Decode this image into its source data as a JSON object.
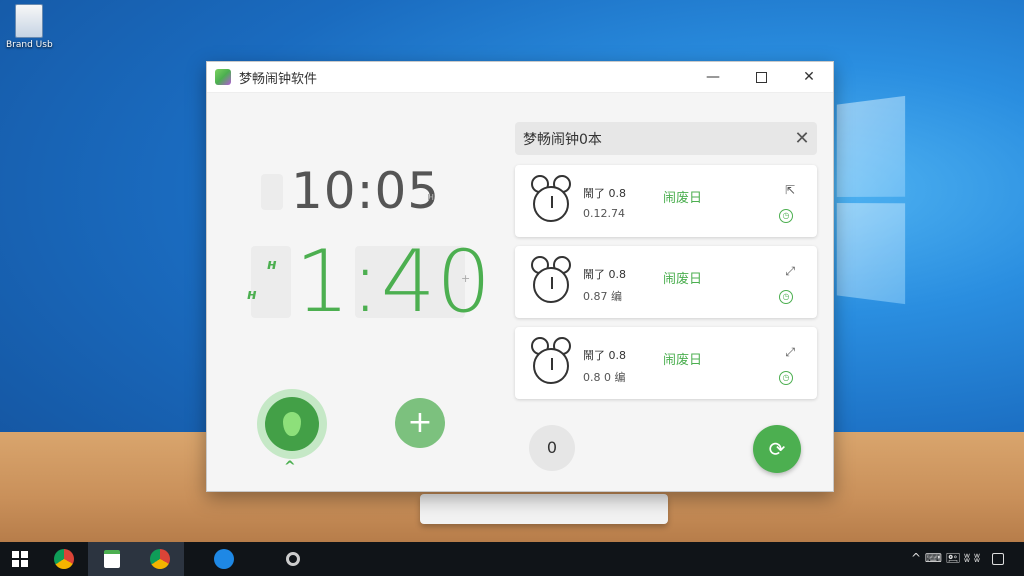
{
  "desktop": {
    "icon_label": "Brand Usb"
  },
  "window": {
    "title": "梦畅闹钟软件",
    "controls": {
      "minimize": "—",
      "close": "✕"
    }
  },
  "clock": {
    "current_time": "10:05",
    "countdown": "1:40",
    "mark_top": "ʜ",
    "mark_bottom": "ʜ",
    "side_mark_top": "ʜ",
    "side_mark_mid": "+"
  },
  "controls": {
    "toggle_chevron": "^",
    "add_label": "+"
  },
  "search": {
    "title": "梦畅闹钟0本",
    "clear_label": "✕"
  },
  "alarms": [
    {
      "line1": "鬧了 0.8",
      "line2": "0.12.74",
      "day": "闹废日",
      "edit": "⇱",
      "clock_glyph": "◷"
    },
    {
      "line1": "鬧了 0.8",
      "line2": "0.87 编",
      "day": "闹废日",
      "edit": "⤢",
      "clock_glyph": "◷"
    },
    {
      "line1": "鬧了 0.8",
      "line2": "0.8 0 编",
      "day": "闹废日",
      "edit": "⤢",
      "clock_glyph": "◷"
    }
  ],
  "footer": {
    "count_label": "0",
    "sync_label": "⟳"
  },
  "taskbar": {
    "apps": [
      "chrome-icon",
      "notes-icon",
      "chrome-alt-icon",
      "browser-icon",
      "settings-icon"
    ],
    "tray_text": "^ ⌨ 🖭 ʬ ʬ"
  }
}
